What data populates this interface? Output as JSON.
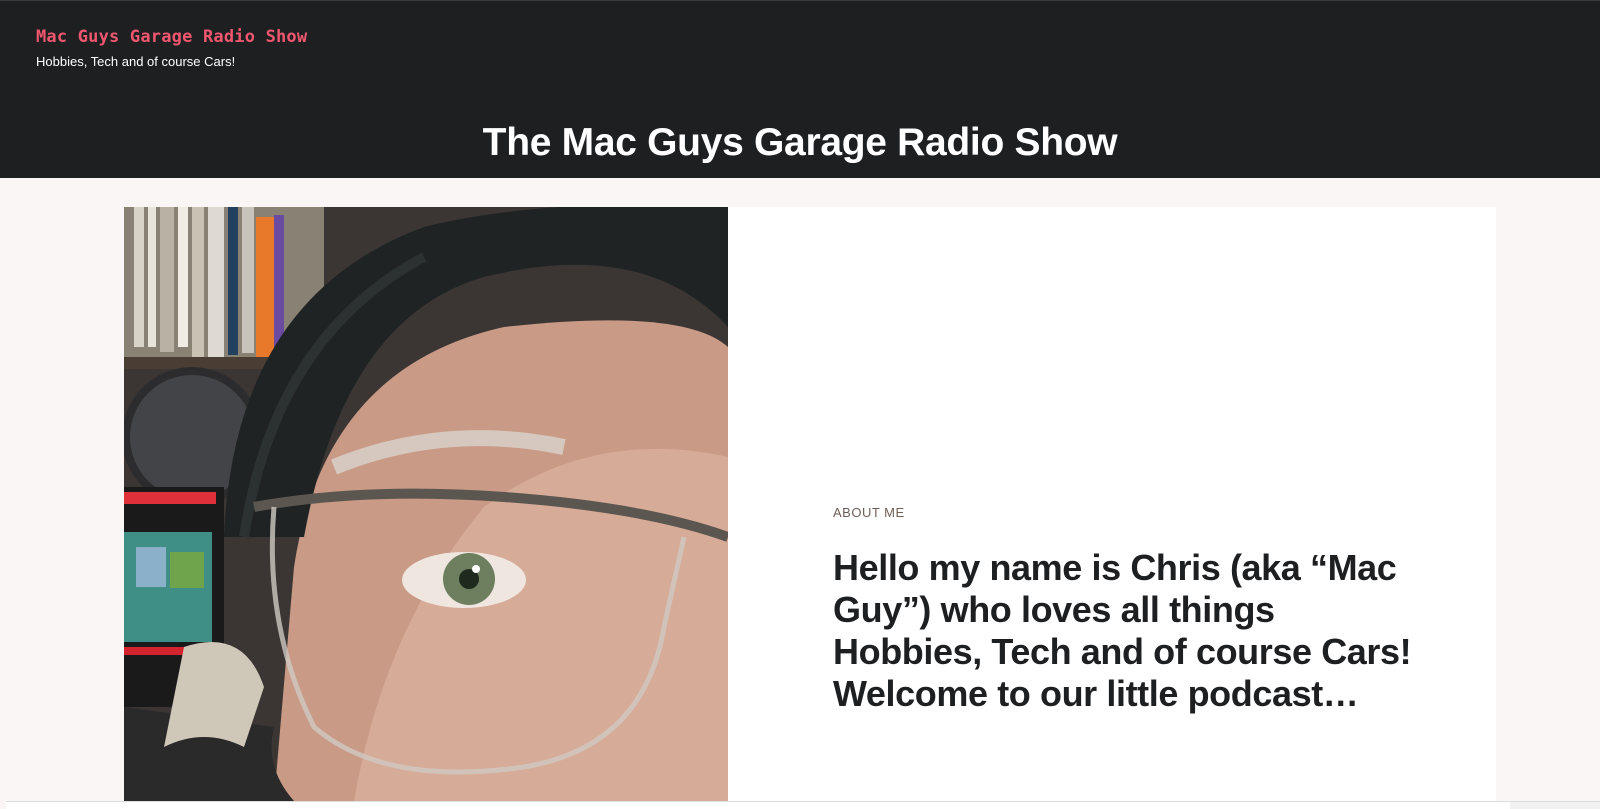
{
  "header": {
    "site_title": "Mac Guys Garage Radio Show",
    "tagline": "Hobbies, Tech and of course Cars!",
    "page_title": "The Mac Guys Garage Radio Show"
  },
  "about": {
    "eyebrow": "ABOUT ME",
    "heading": "Hello my name is Chris (aka “Mac Guy”) who loves all things Hobbies, Tech and of course Cars! Welcome to our little podcast…"
  },
  "colors": {
    "header_bg": "#1e1f21",
    "site_title": "#f0576f",
    "page_bg": "#f9f6f5",
    "card_bg": "#ffffff",
    "heading_text": "#1e1f21"
  }
}
